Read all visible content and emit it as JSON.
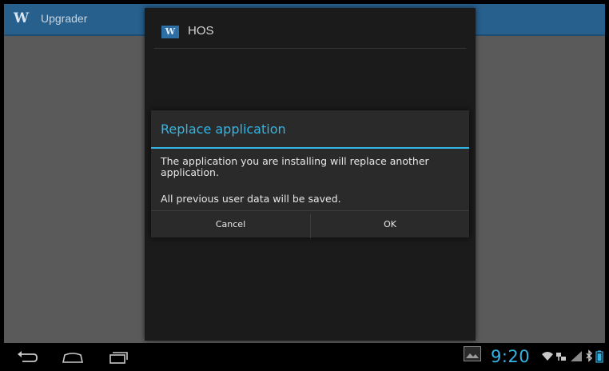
{
  "app": {
    "logo_text": "W",
    "title": "Upgrader"
  },
  "installer": {
    "icon_text": "W",
    "title": "HOS"
  },
  "dialog": {
    "title": "Replace application",
    "message": "The application you are installing will replace another application.",
    "message2": "All previous user data will be saved.",
    "cancel_label": "Cancel",
    "ok_label": "OK"
  },
  "system_bar": {
    "time": "9:20",
    "icons": [
      "back-icon",
      "home-icon",
      "recent-apps-icon",
      "gallery-thumbnail-icon",
      "wifi-icon",
      "network-icon",
      "signal-icon",
      "bluetooth-icon",
      "battery-icon"
    ]
  },
  "colors": {
    "accent": "#33b5e5",
    "app_bar": "#275f8d",
    "dialog_bg": "#2a2a2a"
  }
}
